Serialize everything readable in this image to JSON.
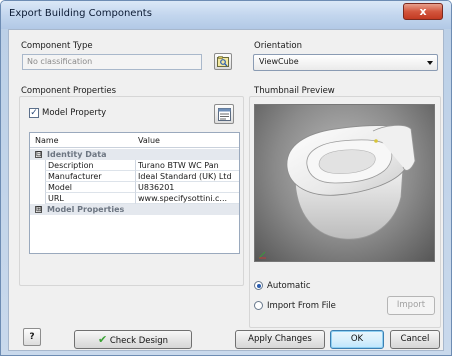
{
  "window": {
    "title": "Export Building Components",
    "close_glyph": "x"
  },
  "component_type": {
    "label": "Component Type",
    "placeholder": "No classification",
    "picker_icon": "classification-picker-icon"
  },
  "orientation": {
    "label": "Orientation",
    "selected": "ViewCube"
  },
  "component_properties": {
    "label": "Component Properties",
    "model_property_label": "Model Property",
    "model_property_checked": true,
    "table": {
      "headers": [
        "Name",
        "Value"
      ],
      "rows": [
        {
          "type": "category",
          "expander": "⊟",
          "name": "Identity Data"
        },
        {
          "type": "data",
          "name": "Description",
          "value": "Turano BTW WC Pan"
        },
        {
          "type": "data",
          "name": "Manufacturer",
          "value": "Ideal Standard (UK) Ltd"
        },
        {
          "type": "data",
          "name": "Model",
          "value": "U836201"
        },
        {
          "type": "data",
          "name": "URL",
          "value": "www.specifysottini.c..."
        },
        {
          "type": "category",
          "expander": "⊞",
          "name": "Model Properties"
        }
      ]
    }
  },
  "thumbnail": {
    "label": "Thumbnail Preview",
    "options": [
      "Automatic",
      "Import From File"
    ],
    "selected": "Automatic",
    "import_label": "Import"
  },
  "footer": {
    "help_label": "?",
    "check_design_label": "Check Design",
    "apply_label": "Apply Changes",
    "ok_label": "OK",
    "cancel_label": "Cancel"
  },
  "colors": {
    "accent": "#2a5db0",
    "title_gradient_top": "#dbe8f7",
    "close_red": "#c23a22",
    "check_green": "#3aa334"
  }
}
